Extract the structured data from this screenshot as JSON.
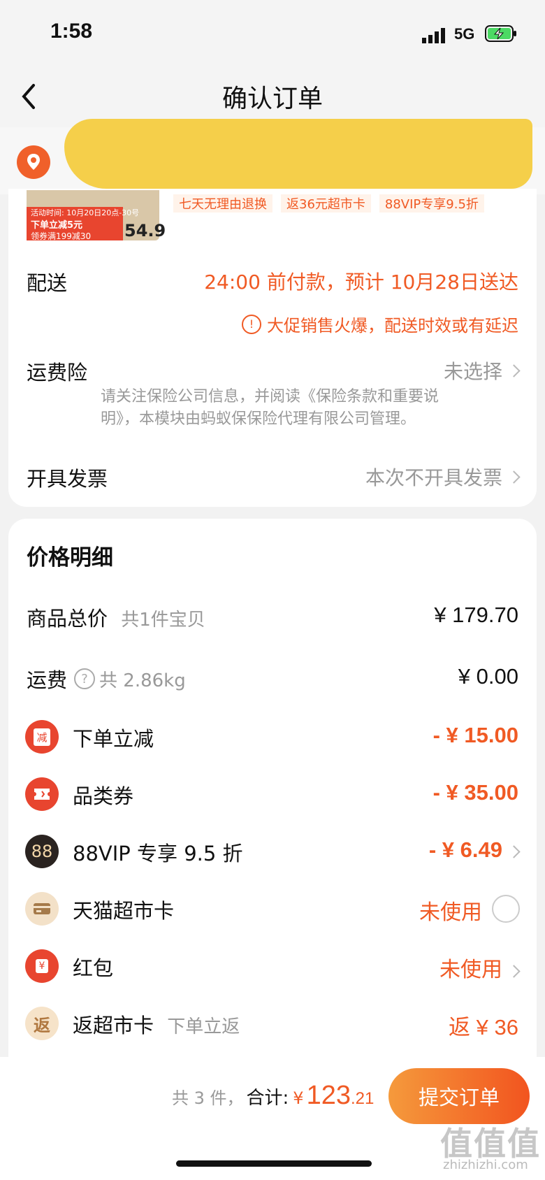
{
  "status_bar": {
    "time": "1:58",
    "network": "5G"
  },
  "header": {
    "title": "确认订单"
  },
  "product": {
    "thumb_tag_top": "活动时间: 10月20日20点-30号",
    "thumb_tag_main": "下单立减5元",
    "thumb_tag_coupon": "领券满199减30",
    "thumb_price": "54.9",
    "service_tags": [
      "七天无理由退换",
      "返36元超市卡",
      "88VIP专享9.5折"
    ]
  },
  "delivery": {
    "label": "配送",
    "value": "24:00 前付款，预计 10月28日送达",
    "notice": "大促销售火爆，配送时效或有延迟"
  },
  "insurance": {
    "label": "运费险",
    "value": "未选择",
    "desc_line1": "请关注保险公司信息，并阅读《保险条款和重要说",
    "desc_line2": "明》，本模块由蚂蚁保保险代理有限公司管理。"
  },
  "invoice": {
    "label": "开具发票",
    "value": "本次不开具发票"
  },
  "price_detail": {
    "title": "价格明细",
    "goods_total": {
      "label": "商品总价",
      "sub": "共1件宝贝",
      "value": "¥ 179.70"
    },
    "shipping": {
      "label": "运费",
      "sub": "共 2.86kg",
      "value": "¥ 0.00"
    },
    "discounts": [
      {
        "icon": "减",
        "label": "下单立减",
        "value": "- ¥ 15.00",
        "color": "#e8452f"
      },
      {
        "icon": "券",
        "label": "品类券",
        "value": "- ¥ 35.00",
        "color": "#e8452f"
      },
      {
        "icon": "88",
        "label": "88VIP 专享 9.5 折",
        "value": "- ¥ 6.49",
        "color": "#2a2320"
      },
      {
        "icon": "卡",
        "label": "天猫超市卡",
        "value": "未使用",
        "color": "#f3e1c8"
      },
      {
        "icon": "¥",
        "label": "红包",
        "value": "未使用",
        "color": "#e8452f"
      },
      {
        "icon": "返",
        "label": "返超市卡",
        "sub": "下单立返",
        "value": "返 ¥ 36",
        "color": "#f6e3c9"
      }
    ]
  },
  "footer": {
    "count": "共 3 件，",
    "total_label": "合计:",
    "currency": "¥",
    "total_int": "123",
    "total_dec": ".21",
    "submit": "提交订单"
  },
  "watermark": {
    "main": "值值值",
    "sub": "zhizhizhi.com"
  }
}
